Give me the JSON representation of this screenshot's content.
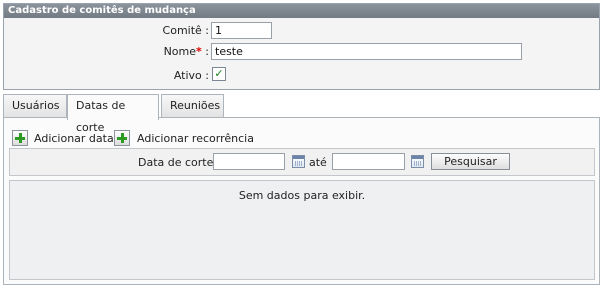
{
  "form": {
    "title": "Cadastro de comitês de mudança",
    "committee_label": "Comitê :",
    "committee_value": "1",
    "name_label": "Nome",
    "name_required": "*",
    "name_colon": " :",
    "name_value": "teste",
    "active_label": "Ativo :",
    "active_checked": true,
    "check_glyph": "✓"
  },
  "tabs": [
    {
      "label": "Usuários",
      "active": false
    },
    {
      "label": "Datas de corte",
      "active": true
    },
    {
      "label": "Reuniões",
      "active": false
    }
  ],
  "toolbar": {
    "add_date_label": "Adicionar data",
    "add_recurrence_label": "Adicionar recorrência"
  },
  "filter": {
    "cutoff_label": "Data de corte :",
    "from_value": "",
    "to_label": "até",
    "to_value": "",
    "search_label": "Pesquisar"
  },
  "grid": {
    "empty_message": "Sem dados para exibir."
  },
  "colors": {
    "header": "#7f878f",
    "plus_icon": "#2d9a22",
    "required": "#dd0000"
  }
}
